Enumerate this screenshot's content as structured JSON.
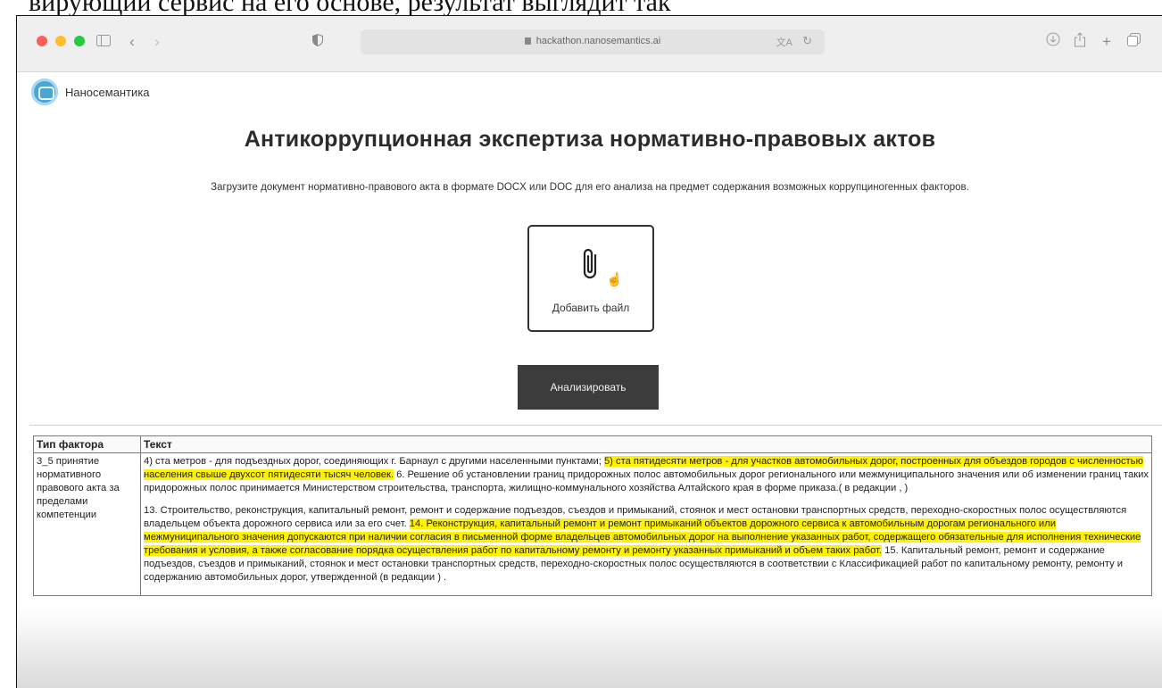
{
  "caption": "вирующий сервис на его основе, результат выглядит так",
  "browser": {
    "url": "hackathon.nanosemantics.ai",
    "traffic_colors": [
      "#ff5f57",
      "#febc2e",
      "#28c840"
    ]
  },
  "brand": {
    "name": "Наносемантика"
  },
  "main": {
    "title": "Антикоррупционная экспертиза нормативно-правовых актов",
    "subtitle": "Загрузите документ нормативно-правового акта в формате DOCX или DOC для его анализа на предмет содержания возможных коррупциногенных факторов.",
    "upload_label": "Добавить файл",
    "analyze_label": "Анализировать"
  },
  "results": {
    "headers": [
      "Тип фактора",
      "Текст"
    ],
    "factor_type": "3_5 принятие нормативного правового акта за пределами компетенции",
    "paragraphs": [
      {
        "segments": [
          {
            "text": "4) ста метров - для подъездных дорог, соединяющих г. Барнаул с другими населенными пунктами; ",
            "highlight": false
          },
          {
            "text": "5) ста пятидесяти метров - для участков автомобильных дорог, построенных для объездов городов с численностью населения свыше двухсот пятидесяти тысяч человек.",
            "highlight": true
          },
          {
            "text": " 6. Решение об установлении границ придорожных полос автомобильных дорог регионального или межмуниципального значения или об изменении границ таких придорожных полос принимается Министерством строительства, транспорта, жилищно-коммунального хозяйства Алтайского края в форме приказа.( в редакции , )",
            "highlight": false
          }
        ]
      },
      {
        "segments": [
          {
            "text": "13. Строительство, реконструкция, капитальный ремонт, ремонт и содержание подъездов, съездов и примыканий, стоянок и мест остановки транспортных средств, переходно-скоростных полос осуществляются владельцем объекта дорожного сервиса или за его счет. ",
            "highlight": false
          },
          {
            "text": "14. Реконструкция, капитальный ремонт и ремонт примыканий объектов дорожного сервиса к автомобильным дорогам регионального или межмуниципального значения допускаются при наличии согласия в письменной форме владельцев автомобильных дорог на выполнение указанных работ, содержащего обязательные для исполнения технические требования и условия, а также согласование порядка осуществления работ по капитальному ремонту и ремонту указанных примыканий и объем таких работ.",
            "highlight": true
          },
          {
            "text": " 15. Капитальный ремонт, ремонт и содержание подъездов, съездов и примыканий, стоянок и мест остановки транспортных средств, переходно-скоростных полос осуществляются в соответствии с Классификацией работ по капитальному ремонту, ремонту и содержанию автомобильных дорог, утвержденной (в редакции ) .",
            "highlight": false
          }
        ]
      }
    ]
  },
  "colors": {
    "highlight": "#fff200",
    "button_bg": "#3c3c3c"
  }
}
